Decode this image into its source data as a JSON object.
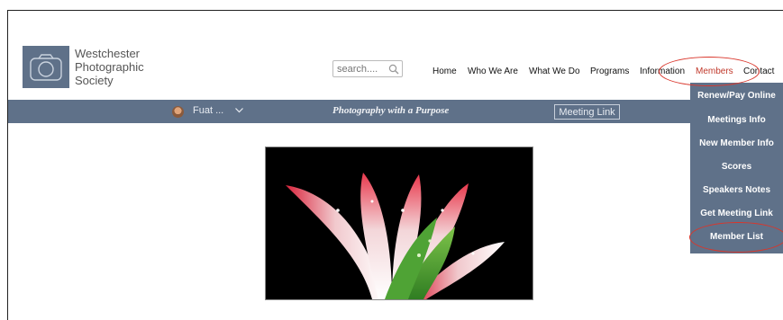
{
  "logo": {
    "text": "Westchester\nPhotographic\nSociety"
  },
  "search": {
    "placeholder": "search...."
  },
  "nav": [
    "Home",
    "Who We Are",
    "What We Do",
    "Programs",
    "Information",
    "Members",
    "Contact"
  ],
  "banner": {
    "user_name": "Fuat ...",
    "tagline": "Photography with a Purpose",
    "meeting_link": "Meeting Link"
  },
  "members_menu": [
    "Renew/Pay Online",
    "Meetings Info",
    "New Member Info",
    "Scores",
    "Speakers Notes",
    "Get Meeting Link",
    "Member List"
  ],
  "colors": {
    "brand_slate": "#5f7189",
    "active_red": "#c0392b",
    "annotation_red": "#d9362b"
  }
}
